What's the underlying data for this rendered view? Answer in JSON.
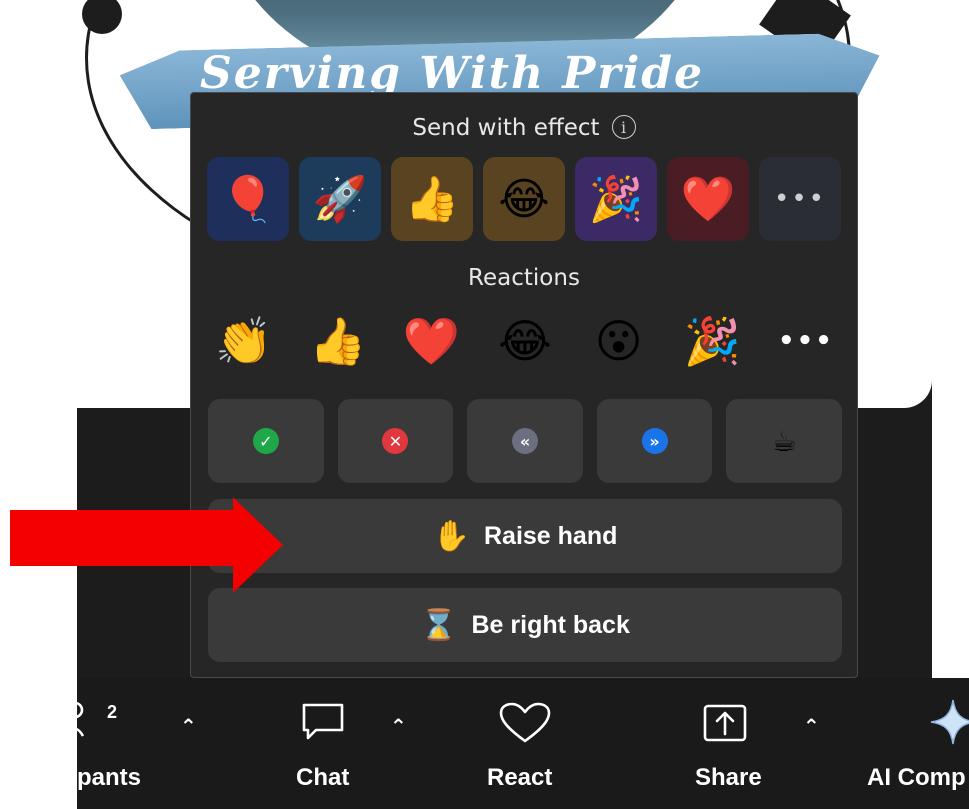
{
  "popup": {
    "effects_title": "Send with effect",
    "effects": [
      {
        "icon": "balloon-icon",
        "glyph": "🎈",
        "bg": "#1f2f5c"
      },
      {
        "icon": "rocket-icon",
        "glyph": "🚀",
        "bg": "#1d3b5b"
      },
      {
        "icon": "thumbs-up-icon",
        "glyph": "👍",
        "bg": "#5a4320"
      },
      {
        "icon": "laughing-face-icon",
        "glyph": "😂",
        "bg": "#5a4320"
      },
      {
        "icon": "party-popper-icon",
        "glyph": "🎉",
        "bg": "#3b2a66"
      },
      {
        "icon": "heart-icon",
        "glyph": "❤️",
        "bg": "#4a1d24"
      },
      {
        "icon": "more-icon",
        "glyph": "•••",
        "bg": "#2b2d35"
      }
    ],
    "reactions_title": "Reactions",
    "reactions": [
      {
        "icon": "clapping-hands-icon",
        "glyph": "👏"
      },
      {
        "icon": "thumbs-up-icon",
        "glyph": "👍"
      },
      {
        "icon": "heart-icon",
        "glyph": "❤️"
      },
      {
        "icon": "laughing-face-icon",
        "glyph": "😂"
      },
      {
        "icon": "surprised-face-icon",
        "glyph": "😮"
      },
      {
        "icon": "party-popper-icon",
        "glyph": "🎉"
      },
      {
        "icon": "more-icon",
        "glyph": "•••"
      }
    ],
    "status": [
      {
        "icon": "yes-check-icon",
        "glyph": "✓",
        "color": "#1fa84a"
      },
      {
        "icon": "no-x-icon",
        "glyph": "✕",
        "color": "#e0383e"
      },
      {
        "icon": "slower-icon",
        "glyph": "«",
        "color": "#6b6f80"
      },
      {
        "icon": "faster-icon",
        "glyph": "»",
        "color": "#1a73e8"
      },
      {
        "icon": "coffee-icon",
        "glyph": "☕",
        "color": ""
      }
    ],
    "raise_hand": {
      "icon": "raised-hand-icon",
      "glyph": "✋",
      "label": "Raise hand"
    },
    "be_right_back": {
      "icon": "hourglass-icon",
      "glyph": "⌛",
      "label": "Be right back"
    }
  },
  "toolbar": {
    "participants": {
      "label": "pants",
      "count": "2"
    },
    "chat": {
      "label": "Chat"
    },
    "react": {
      "label": "React"
    },
    "share": {
      "label": "Share"
    },
    "ai": {
      "label": "AI Comp"
    }
  },
  "background": {
    "banner_text": "Serving With Pride"
  },
  "colors": {
    "annotation_arrow": "#f40000",
    "popup_bg": "#262626",
    "button_bg": "#3a3a3a"
  }
}
